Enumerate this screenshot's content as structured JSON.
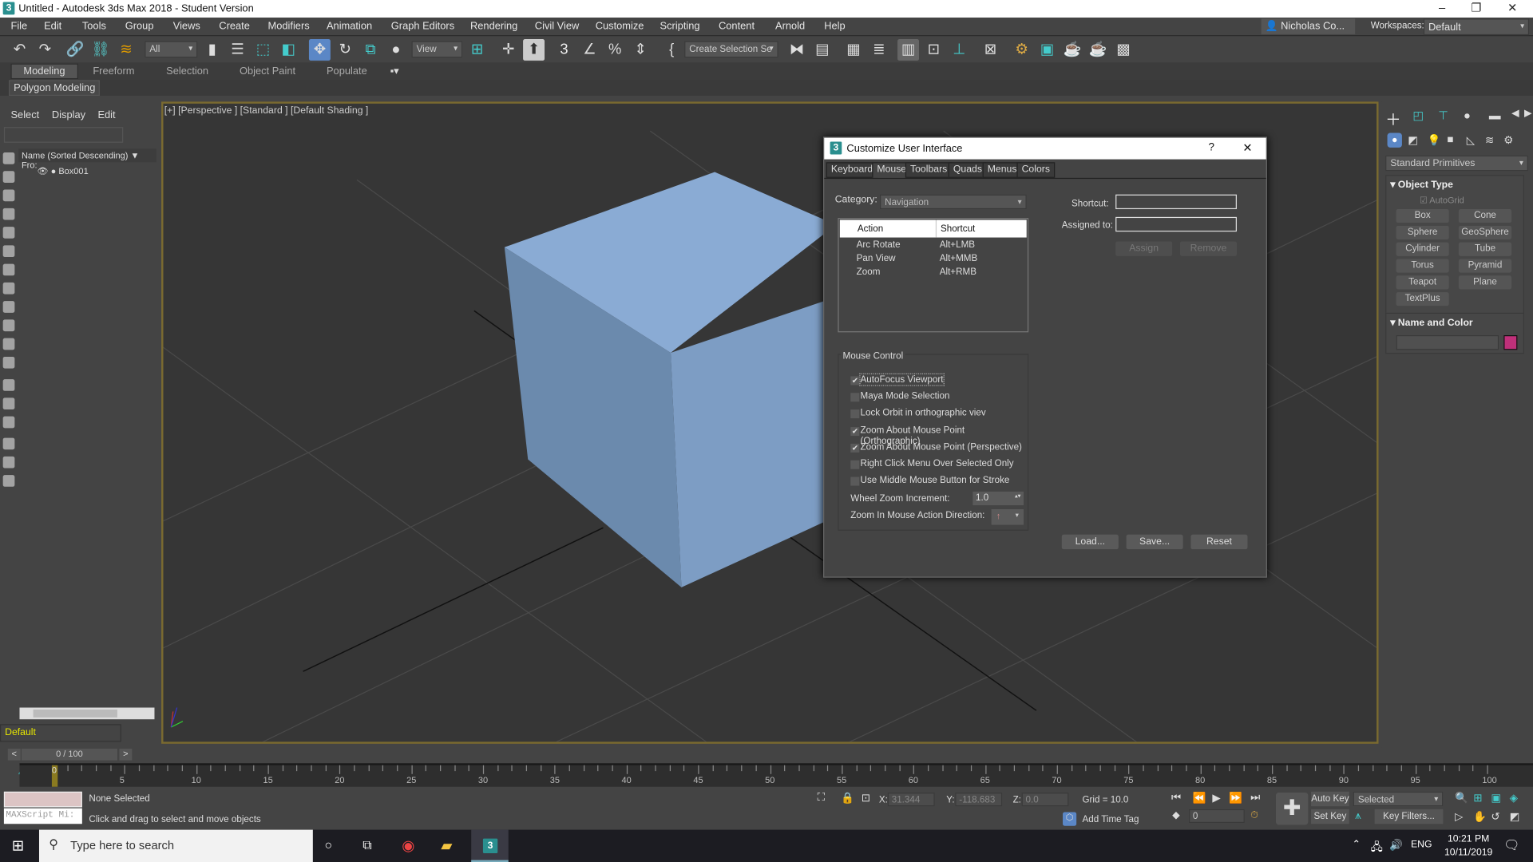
{
  "app": {
    "title": "Untitled - Autodesk 3ds Max 2018 - Student Version",
    "logo": "3"
  },
  "menu": [
    "File",
    "Edit",
    "Tools",
    "Group",
    "Views",
    "Create",
    "Modifiers",
    "Animation",
    "Graph Editors",
    "Rendering",
    "Civil View",
    "Customize",
    "Scripting",
    "Content",
    "Arnold",
    "Help"
  ],
  "user": {
    "name": "Nicholas Co...",
    "workspaces_label": "Workspaces:",
    "workspace": "Default"
  },
  "toolbar": {
    "filter": "All",
    "ref_coord": "View",
    "named_selection": "Create Selection Se"
  },
  "ribbon": {
    "tabs": [
      "Modeling",
      "Freeform",
      "Selection",
      "Object Paint",
      "Populate"
    ],
    "active": "Modeling",
    "panel": "Polygon Modeling"
  },
  "explorer": {
    "menu": [
      "Select",
      "Display",
      "Edit"
    ],
    "column": "Name (Sorted Descending)",
    "column2": "Fro:",
    "items": [
      {
        "name": "Box001"
      }
    ],
    "layer": "Default",
    "frame": "0 / 100"
  },
  "viewport": {
    "label": "[+] [Perspective ] [Standard ] [Default Shading ]",
    "cube_top": "#8aabd4",
    "cube_left": "#6b8aad",
    "cube_right": "#7d9dc4",
    "border": "#7a6a30"
  },
  "right_panel": {
    "category": "Standard Primitives",
    "object_type": "Object Type",
    "autogrid": "AutoGrid",
    "buttons": [
      "Box",
      "Cone",
      "Sphere",
      "GeoSphere",
      "Cylinder",
      "Tube",
      "Torus",
      "Pyramid",
      "Teapot",
      "Plane",
      "TextPlus"
    ],
    "name_color": "Name and Color",
    "color": "#c0307a"
  },
  "dialog": {
    "title": "Customize User Interface",
    "help": "?",
    "close": "✕",
    "tabs": [
      "Keyboard",
      "Mouse",
      "Toolbars",
      "Quads",
      "Menus",
      "Colors"
    ],
    "active_tab": "Mouse",
    "category_label": "Category:",
    "category": "Navigation",
    "table": {
      "headers": [
        "Action",
        "Shortcut"
      ],
      "rows": [
        [
          "Arc Rotate",
          "Alt+LMB"
        ],
        [
          "Pan View",
          "Alt+MMB"
        ],
        [
          "Zoom",
          "Alt+RMB"
        ]
      ]
    },
    "shortcut_label": "Shortcut:",
    "assigned_label": "Assigned to:",
    "shortcut": "",
    "assigned": "",
    "assign": "Assign",
    "remove": "Remove",
    "group": "Mouse Control",
    "checks": [
      {
        "label": "AutoFocus Viewport",
        "checked": true
      },
      {
        "label": "Maya Mode Selection",
        "checked": false
      },
      {
        "label": "Lock Orbit in orthographic viev",
        "checked": false
      },
      {
        "label": "Zoom About Mouse Point (Orthographic)",
        "checked": true
      },
      {
        "label": "Zoom About Mouse Point (Perspective)",
        "checked": true
      },
      {
        "label": "Right Click Menu Over Selected Only",
        "checked": false
      },
      {
        "label": "Use Middle Mouse Button for Stroke",
        "checked": false
      }
    ],
    "wheel_label": "Wheel Zoom Increment:",
    "wheel": "1.0",
    "dir_label": "Zoom In Mouse Action Direction:",
    "dir": "↑",
    "load": "Load...",
    "save": "Save...",
    "reset": "Reset"
  },
  "timeline": {
    "start": 0,
    "end": 100,
    "current": 0
  },
  "status": {
    "selection": "None Selected",
    "prompt": "Click and drag to select and move objects",
    "maxscript": "MAXScript Mi:",
    "x_label": "X:",
    "x": "31.344",
    "y_label": "Y:",
    "y": "-118.683",
    "z_label": "Z:",
    "z": "0.0",
    "grid": "Grid = 10.0",
    "add_time_tag": "Add Time Tag",
    "frame": "0",
    "auto_key": "Auto Key",
    "set_key": "Set Key",
    "key_mode": "Selected",
    "key_filters": "Key Filters..."
  },
  "taskbar": {
    "search": "Type here to search",
    "time": "10:21 PM",
    "date": "10/11/2019",
    "lang": "ENG"
  }
}
